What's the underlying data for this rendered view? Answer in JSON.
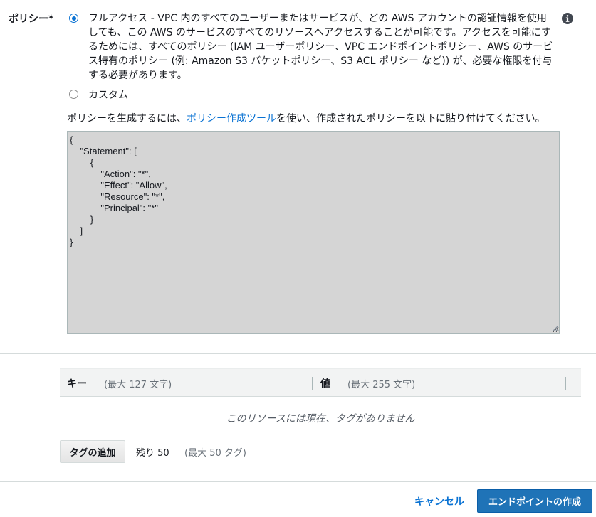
{
  "policy": {
    "label": "ポリシー*",
    "options": [
      {
        "label": "フルアクセス - VPC 内のすべてのユーザーまたはサービスが、どの AWS アカウントの認証情報を使用しても、この AWS のサービスのすべてのリソースへアクセスすることが可能です。アクセスを可能にするためには、すべてのポリシー (IAM ユーザーポリシー、VPC エンドポイントポリシー、AWS のサービス特有のポリシー (例: Amazon S3 バケットポリシー、S3 ACL ポリシー など)) が、必要な権限を付与する必要があります。",
        "selected": true
      },
      {
        "label": "カスタム",
        "selected": false
      }
    ],
    "helper_prefix": "ポリシーを生成するには、",
    "helper_link": "ポリシー作成ツール",
    "helper_suffix": "を使い、作成されたポリシーを以下に貼り付けてください。",
    "document": "{\n    \"Statement\": [\n        {\n            \"Action\": \"*\",\n            \"Effect\": \"Allow\",\n            \"Resource\": \"*\",\n            \"Principal\": \"*\"\n        }\n    ]\n}"
  },
  "tags": {
    "key_header": "キー",
    "key_hint": "(最大 127 文字)",
    "value_header": "値",
    "value_hint": "(最大 255 文字)",
    "empty_message": "このリソースには現在、タグがありません",
    "add_button": "タグの追加",
    "remaining": "残り 50",
    "max": "(最大 50 タグ)"
  },
  "footer": {
    "cancel": "キャンセル",
    "create": "エンドポイントの作成"
  },
  "colors": {
    "accent": "#0972d3",
    "primary_button": "#1f73b7",
    "editor_bg": "#d5d5d5"
  },
  "icons": {
    "info": "info-icon"
  }
}
